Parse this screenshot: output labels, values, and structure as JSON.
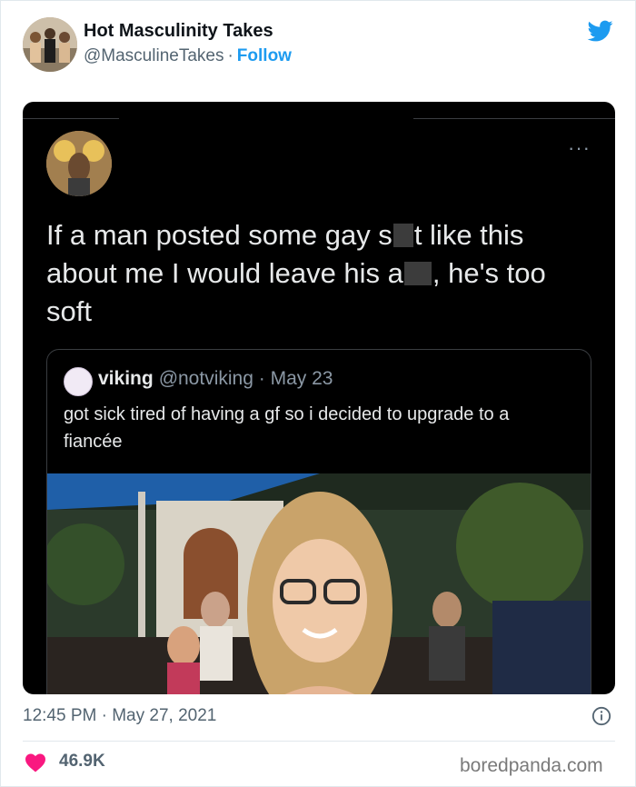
{
  "author": {
    "display_name": "Hot Masculinity Takes",
    "handle": "@MasculineTakes",
    "separator": "·",
    "follow_label": "Follow"
  },
  "icons": {
    "brand": "twitter-bird-icon",
    "more": "more-options-icon",
    "info": "info-icon",
    "like": "heart-icon"
  },
  "colors": {
    "twitter_blue": "#1d9bf0",
    "heart_pink": "#f91880",
    "dark_background": "#000000"
  },
  "embedded_tweet": {
    "text_line1_a": "If a man posted some gay s",
    "text_line1_b": "t like this",
    "text_line2_a": "about me I would leave his a",
    "text_line2_b": ", he's too",
    "text_line3": "soft",
    "more_dots": "···",
    "quote": {
      "name": "viking",
      "handle": "@notviking",
      "separator": "·",
      "date": "May 23",
      "text": "got sick tired of having a gf so i decided to upgrade to a fiancée"
    }
  },
  "footer": {
    "timestamp": "12:45 PM · May 27, 2021",
    "likes": "46.9K",
    "watermark": "boredpanda.com"
  }
}
